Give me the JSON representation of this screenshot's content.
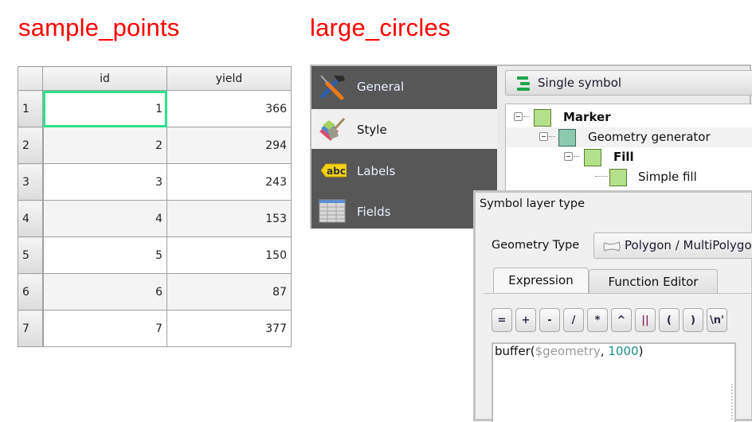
{
  "titles": {
    "left": "sample_points",
    "right": "large_circles"
  },
  "attribute_table": {
    "columns": [
      "id",
      "yield"
    ],
    "rows": [
      {
        "row": "1",
        "id": "1",
        "yield": "366",
        "selected": true
      },
      {
        "row": "2",
        "id": "2",
        "yield": "294"
      },
      {
        "row": "3",
        "id": "3",
        "yield": "243"
      },
      {
        "row": "4",
        "id": "4",
        "yield": "153"
      },
      {
        "row": "5",
        "id": "5",
        "yield": "150"
      },
      {
        "row": "6",
        "id": "6",
        "yield": "87"
      },
      {
        "row": "7",
        "id": "7",
        "yield": "377"
      }
    ],
    "selection_color": "#2de28a"
  },
  "layer_properties": {
    "sidebar": [
      {
        "label": "General",
        "icon": "hammer-screwdriver-icon"
      },
      {
        "label": "Style",
        "icon": "paintbrush-icon",
        "active": true
      },
      {
        "label": "Labels",
        "icon": "abc-label-icon"
      },
      {
        "label": "Fields",
        "icon": "table-fields-icon"
      }
    ],
    "renderer": "Single symbol",
    "symbol_tree": [
      {
        "label": "Marker",
        "bold": true,
        "color": "#b3e08a"
      },
      {
        "label": "Geometry generator",
        "bold": false,
        "color": "#8ccab0"
      },
      {
        "label": "Fill",
        "bold": true,
        "color": "#b3e08a"
      },
      {
        "label": "Simple fill",
        "bold": false,
        "color": "#b3e08a"
      }
    ]
  },
  "symbol_layer": {
    "header": "Symbol layer type",
    "geometry_type_label": "Geometry Type",
    "geometry_type_value": "Polygon / MultiPolygon",
    "tabs": [
      "Expression",
      "Function Editor"
    ],
    "operators": [
      "=",
      "+",
      "-",
      "/",
      "*",
      "^",
      "||",
      "(",
      ")",
      "\\n'"
    ],
    "expression": {
      "prefix": "buffer(",
      "variable": "$geometry",
      "sep": ", ",
      "number": "1000",
      "suffix": ")"
    }
  }
}
